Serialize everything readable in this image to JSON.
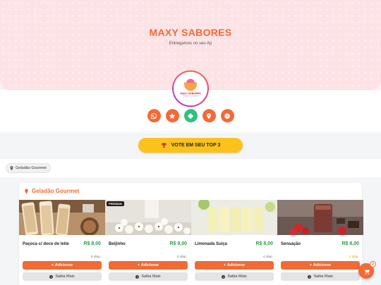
{
  "header": {
    "title": "MAXY SABORES",
    "subtitle": "Entregamos no seu Ap",
    "logo_text": "MAXY SABORES",
    "logo_small": "Sorvetes de Lavinha"
  },
  "socials": [
    {
      "icon": "whatsapp-icon",
      "color": "#f26a35"
    },
    {
      "icon": "star-icon",
      "color": "#f26a35"
    },
    {
      "icon": "diamond-icon",
      "color": "#2ec27e"
    },
    {
      "icon": "location-icon",
      "color": "#f26a35"
    },
    {
      "icon": "clock-icon",
      "color": "#f26a35"
    }
  ],
  "vote": {
    "label": "VOTE EM SEU TOP 3",
    "icon": "trophy-icon"
  },
  "filter_chip": {
    "label": "Geladão Gourmet",
    "icon": "pin-icon"
  },
  "section": {
    "title": "Geladão Gourmet",
    "icon": "ice-cream-icon",
    "products": [
      {
        "name": "Paçoca c/ doce de leite",
        "price": "R$ 8,00",
        "stock": "8 disp.",
        "badge": "",
        "add_label": "Adicionar",
        "more_label": "Saiba Mais"
      },
      {
        "name": "Beijinho",
        "price": "R$ 9,00",
        "stock": "5 disp.",
        "badge": "PREMIUM",
        "add_label": "Adicionar",
        "more_label": "Saiba Mais"
      },
      {
        "name": "Limonada Suiça",
        "price": "R$ 8,00",
        "stock": "4 disp.",
        "badge": "",
        "add_label": "Adicionar",
        "more_label": "Saiba Mais"
      },
      {
        "name": "Sensação",
        "price": "R$ 8,00",
        "stock": "1 disp.",
        "badge": "",
        "add_label": "Adicionar",
        "more_label": "Saiba Mais"
      }
    ]
  },
  "cart": {
    "count": "0",
    "icon": "cart-icon"
  },
  "colors": {
    "accent": "#f26a35",
    "price": "#2e9c3e",
    "vote": "#fcc21b",
    "hero_bg": "#fde2e6"
  }
}
